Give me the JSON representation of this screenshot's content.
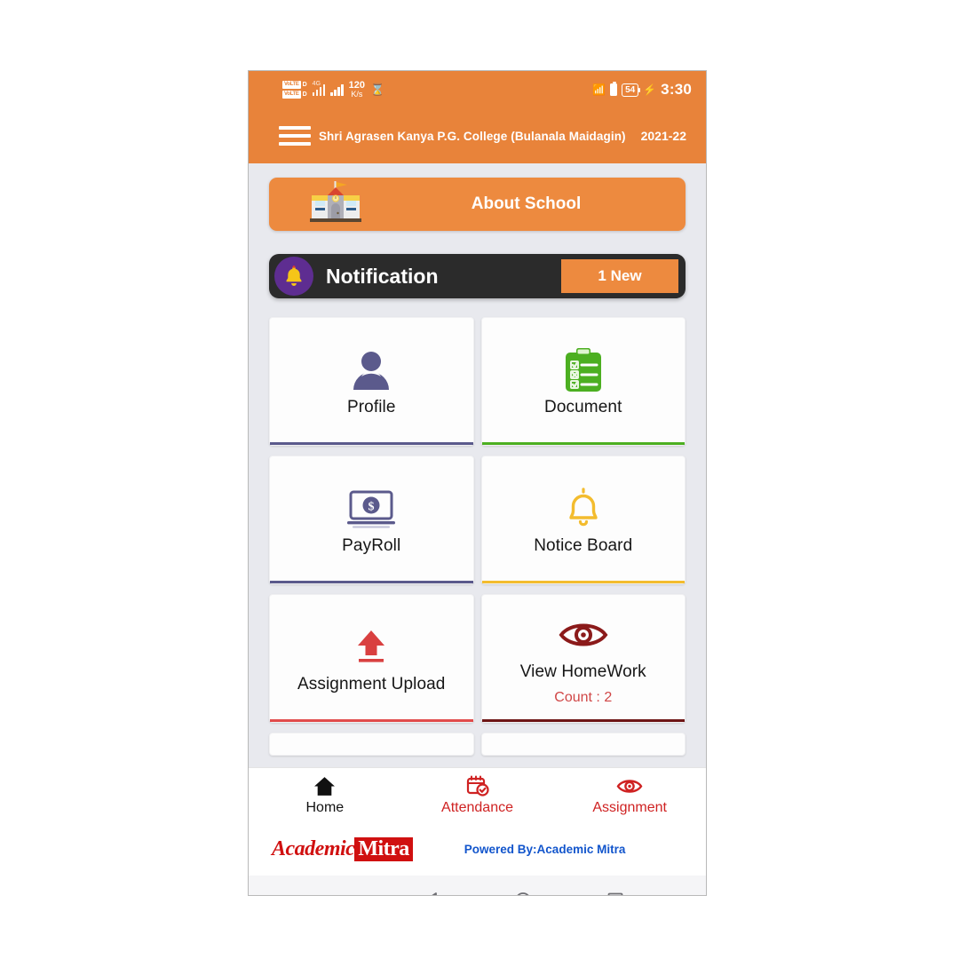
{
  "statusbar": {
    "volte_label": "VoLTE",
    "sim1": "D",
    "sim2": "D",
    "network_gen": "4G",
    "data_rate_value": "120",
    "data_rate_unit": "K/s",
    "hourglass_icon": "hourglass-icon",
    "bluetooth_icon": "bluetooth-icon",
    "battery_level": "54",
    "charging_icon": "charging-bolt-icon",
    "time": "3:30"
  },
  "appbar": {
    "menu_icon": "hamburger-menu-icon",
    "title": "Shri Agrasen Kanya P.G. College (Bulanala Maidagin)",
    "session": "2021-22",
    "background_color": "#E8833A"
  },
  "about": {
    "icon": "school-building-icon",
    "icon_glyph": "🏫",
    "label": "About School",
    "background_color": "#ED8A3F"
  },
  "notification": {
    "icon": "bell-icon",
    "icon_glyph": "🔔",
    "label": "Notification",
    "badge": "1 New",
    "badge_color": "#ED8A3F",
    "background_color": "#2B2B2B"
  },
  "grid": {
    "tiles": [
      {
        "label": "Profile",
        "icon": "person-icon",
        "accent": "#5B5A8C",
        "icon_color": "#5B5A8C",
        "sub": ""
      },
      {
        "label": "Document",
        "icon": "clipboard-icon",
        "accent": "#4CAF21",
        "icon_color": "#4CAF21",
        "sub": ""
      },
      {
        "label": "PayRoll",
        "icon": "money-laptop-icon",
        "accent": "#5B5A8C",
        "icon_color": "#5B5A8C",
        "sub": ""
      },
      {
        "label": "Notice Board",
        "icon": "bell-outline-icon",
        "accent": "#F3BC2E",
        "icon_color": "#F3BC2E",
        "sub": ""
      },
      {
        "label": "Assignment Upload",
        "icon": "upload-arrow-icon",
        "accent": "#E14B4B",
        "icon_color": "#D94040",
        "sub": ""
      },
      {
        "label": "View HomeWork",
        "icon": "eye-icon",
        "accent": "#6E1515",
        "icon_color": "#8B1A1A",
        "sub": "Count : 2"
      }
    ]
  },
  "bottomnav": {
    "items": [
      {
        "label": "Home",
        "icon": "home-icon",
        "color": "#111111"
      },
      {
        "label": "Attendance",
        "icon": "calendar-check-icon",
        "color": "#CF2222"
      },
      {
        "label": "Assignment",
        "icon": "eye-icon",
        "color": "#CF2222"
      }
    ]
  },
  "footer": {
    "logo_part1": "Academic",
    "logo_part2": "Mitra",
    "powered_by": "Powered By:Academic Mitra",
    "powered_color": "#1255CC",
    "logo_color": "#D01010"
  },
  "androidnav": {
    "buttons": [
      {
        "icon": "chevron-down-icon"
      },
      {
        "icon": "back-triangle-icon"
      },
      {
        "icon": "home-circle-icon"
      },
      {
        "icon": "recents-square-icon"
      }
    ]
  }
}
